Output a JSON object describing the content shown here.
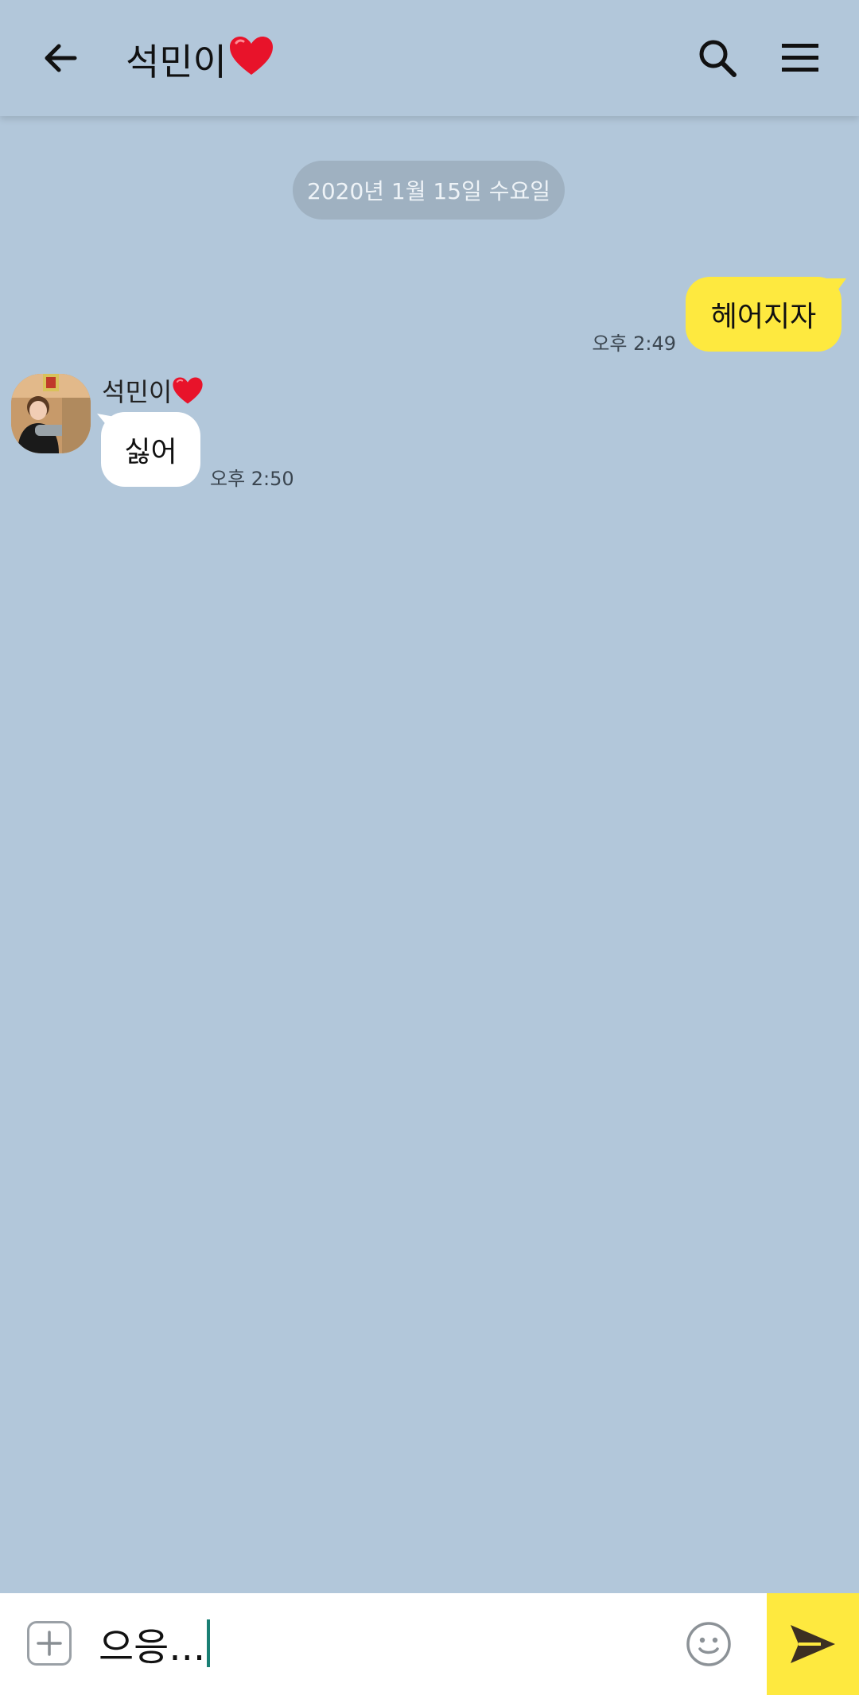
{
  "header": {
    "title": "석민이",
    "title_emoji": "❤️",
    "back_icon": "arrow-left-icon",
    "search_icon": "search-icon",
    "menu_icon": "hamburger-menu-icon"
  },
  "chat": {
    "date_divider": "2020년 1월 15일 수요일",
    "messages": [
      {
        "direction": "sent",
        "text": "헤어지자",
        "time": "오후 2:49"
      },
      {
        "direction": "received",
        "sender": "석민이",
        "sender_emoji": "❤️",
        "text": "싫어",
        "time": "오후 2:50"
      }
    ]
  },
  "composer": {
    "text": "으응...",
    "plus_icon": "plus-square-icon",
    "emoji_icon": "emoticon-icon",
    "send_icon": "send-icon"
  },
  "colors": {
    "chat_background": "#b2c7da",
    "sent_bubble": "#fee93f",
    "received_bubble": "#ffffff",
    "send_button": "#fee93f",
    "caret": "#1a7f74"
  }
}
